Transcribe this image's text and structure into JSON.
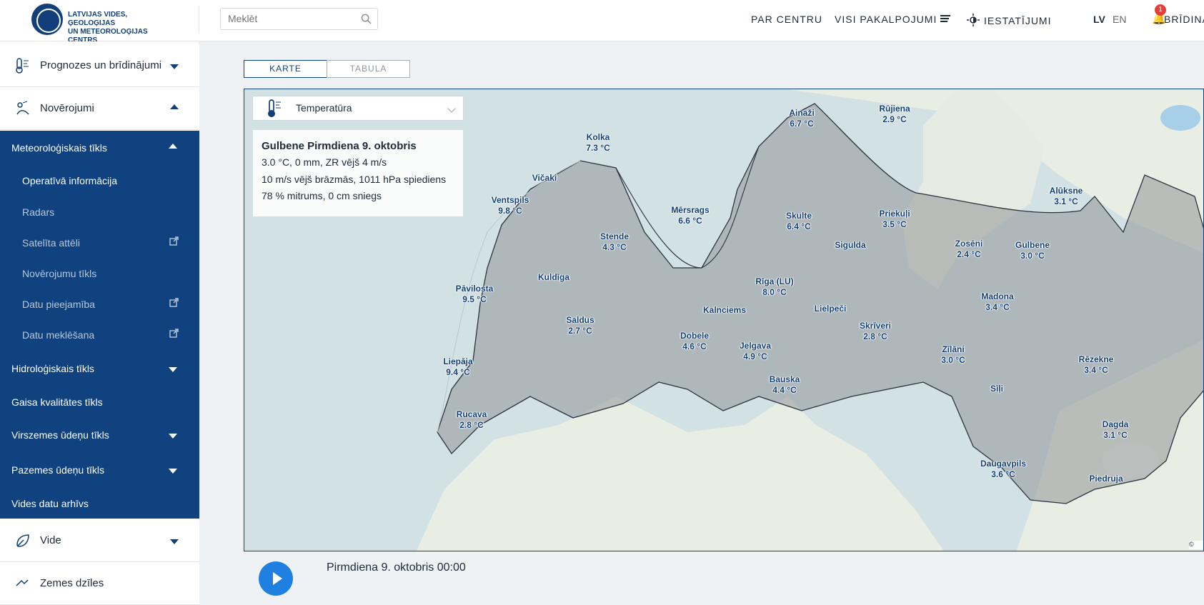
{
  "header": {
    "logo_line1": "LATVIJAS VIDES, ĢEOLOĢIJAS",
    "logo_line2": "UN METEOROLOĢIJAS CENTRS",
    "search_placeholder": "Meklēt",
    "nav": [
      "PAR CENTRU",
      "VISI PAKALPOJUMI",
      "IESTATĪJUMI"
    ],
    "lang_active": "LV",
    "lang_other": "EN",
    "notifications_count": "1",
    "warnings_label": "BRĪDINĀ"
  },
  "sidebar": {
    "main_items": [
      "Prognozes un brīdinājumi",
      "Novērojumi",
      "Vide",
      "Zemes dzīles"
    ],
    "blue_items": [
      {
        "label": "Meteoroloģiskais tīkls",
        "state": "open"
      },
      {
        "label": "Hidroloģiskais tīkls",
        "state": "closed"
      },
      {
        "label": "Gaisa kvalitātes tīkls",
        "state": "none"
      },
      {
        "label": "Virszemes ūdeņu tīkls",
        "state": "closed"
      },
      {
        "label": "Pazemes ūdeņu tīkls",
        "state": "closed"
      },
      {
        "label": "Vides datu arhīvs",
        "state": "none"
      }
    ],
    "sub_items": [
      {
        "label": "Operatīvā informācija",
        "active": true,
        "external": false
      },
      {
        "label": "Radars",
        "active": false,
        "external": false
      },
      {
        "label": "Satelīta attēli",
        "active": false,
        "external": true
      },
      {
        "label": "Novērojumu tīkls",
        "active": false,
        "external": false
      },
      {
        "label": "Datu pieejamība",
        "active": false,
        "external": true
      },
      {
        "label": "Datu meklēšana",
        "active": false,
        "external": true
      }
    ]
  },
  "tabs": {
    "active": "KARTE",
    "inactive": "TABULA"
  },
  "map": {
    "selected_layer": "Temperatūra",
    "info": {
      "title": "Gulbene Pirmdiena 9. oktobris",
      "line1": "3.0 °C, 0 mm, ZR vējš 4 m/s",
      "line2": "10 m/s vējš brāzmās, 1011 hPa spiediens",
      "line3": "78 % mitrums, 0 cm sniegs"
    },
    "stations": [
      {
        "name": "Ainaži",
        "temp": "6.7 °C"
      },
      {
        "name": "Rūjiena",
        "temp": "2.9 °C"
      },
      {
        "name": "Kolka",
        "temp": "7.3 °C"
      },
      {
        "name": "Vičaki",
        "temp": ""
      },
      {
        "name": "Ventspils",
        "temp": "9.8 °C"
      },
      {
        "name": "Mērsrags",
        "temp": "6.6 °C"
      },
      {
        "name": "Skulte",
        "temp": "6.4 °C"
      },
      {
        "name": "Priekuļi",
        "temp": "3.5 °C"
      },
      {
        "name": "Alūksne",
        "temp": "3.1 °C"
      },
      {
        "name": "Stende",
        "temp": "4.3 °C"
      },
      {
        "name": "Sigulda",
        "temp": ""
      },
      {
        "name": "Zosēni",
        "temp": "2.4 °C"
      },
      {
        "name": "Gulbene",
        "temp": "3.0 °C"
      },
      {
        "name": "Kuldīga",
        "temp": ""
      },
      {
        "name": "Pāvilosta",
        "temp": "9.5 °C"
      },
      {
        "name": "Rīga (LU)",
        "temp": "8.0 °C"
      },
      {
        "name": "Madona",
        "temp": "3.4 °C"
      },
      {
        "name": "Kalnciems",
        "temp": ""
      },
      {
        "name": "Lielpeči",
        "temp": ""
      },
      {
        "name": "Saldus",
        "temp": "2.7 °C"
      },
      {
        "name": "Skrīveri",
        "temp": "2.8 °C"
      },
      {
        "name": "Dobele",
        "temp": "4.6 °C"
      },
      {
        "name": "Jelgava",
        "temp": "4.9 °C"
      },
      {
        "name": "Zīlāni",
        "temp": "3.0 °C"
      },
      {
        "name": "Rēzekne",
        "temp": "3.4 °C"
      },
      {
        "name": "Liepāja",
        "temp": "9.4 °C"
      },
      {
        "name": "Bauska",
        "temp": "4.4 °C"
      },
      {
        "name": "Sīļi",
        "temp": ""
      },
      {
        "name": "Rucava",
        "temp": "2.8 °C"
      },
      {
        "name": "Dagda",
        "temp": "3.1 °C"
      },
      {
        "name": "Daugavpils",
        "temp": "3.6 °C"
      },
      {
        "name": "Piedruja",
        "temp": ""
      }
    ]
  },
  "timeline": {
    "label": "Pirmdiena 9. oktobris 00:00"
  }
}
